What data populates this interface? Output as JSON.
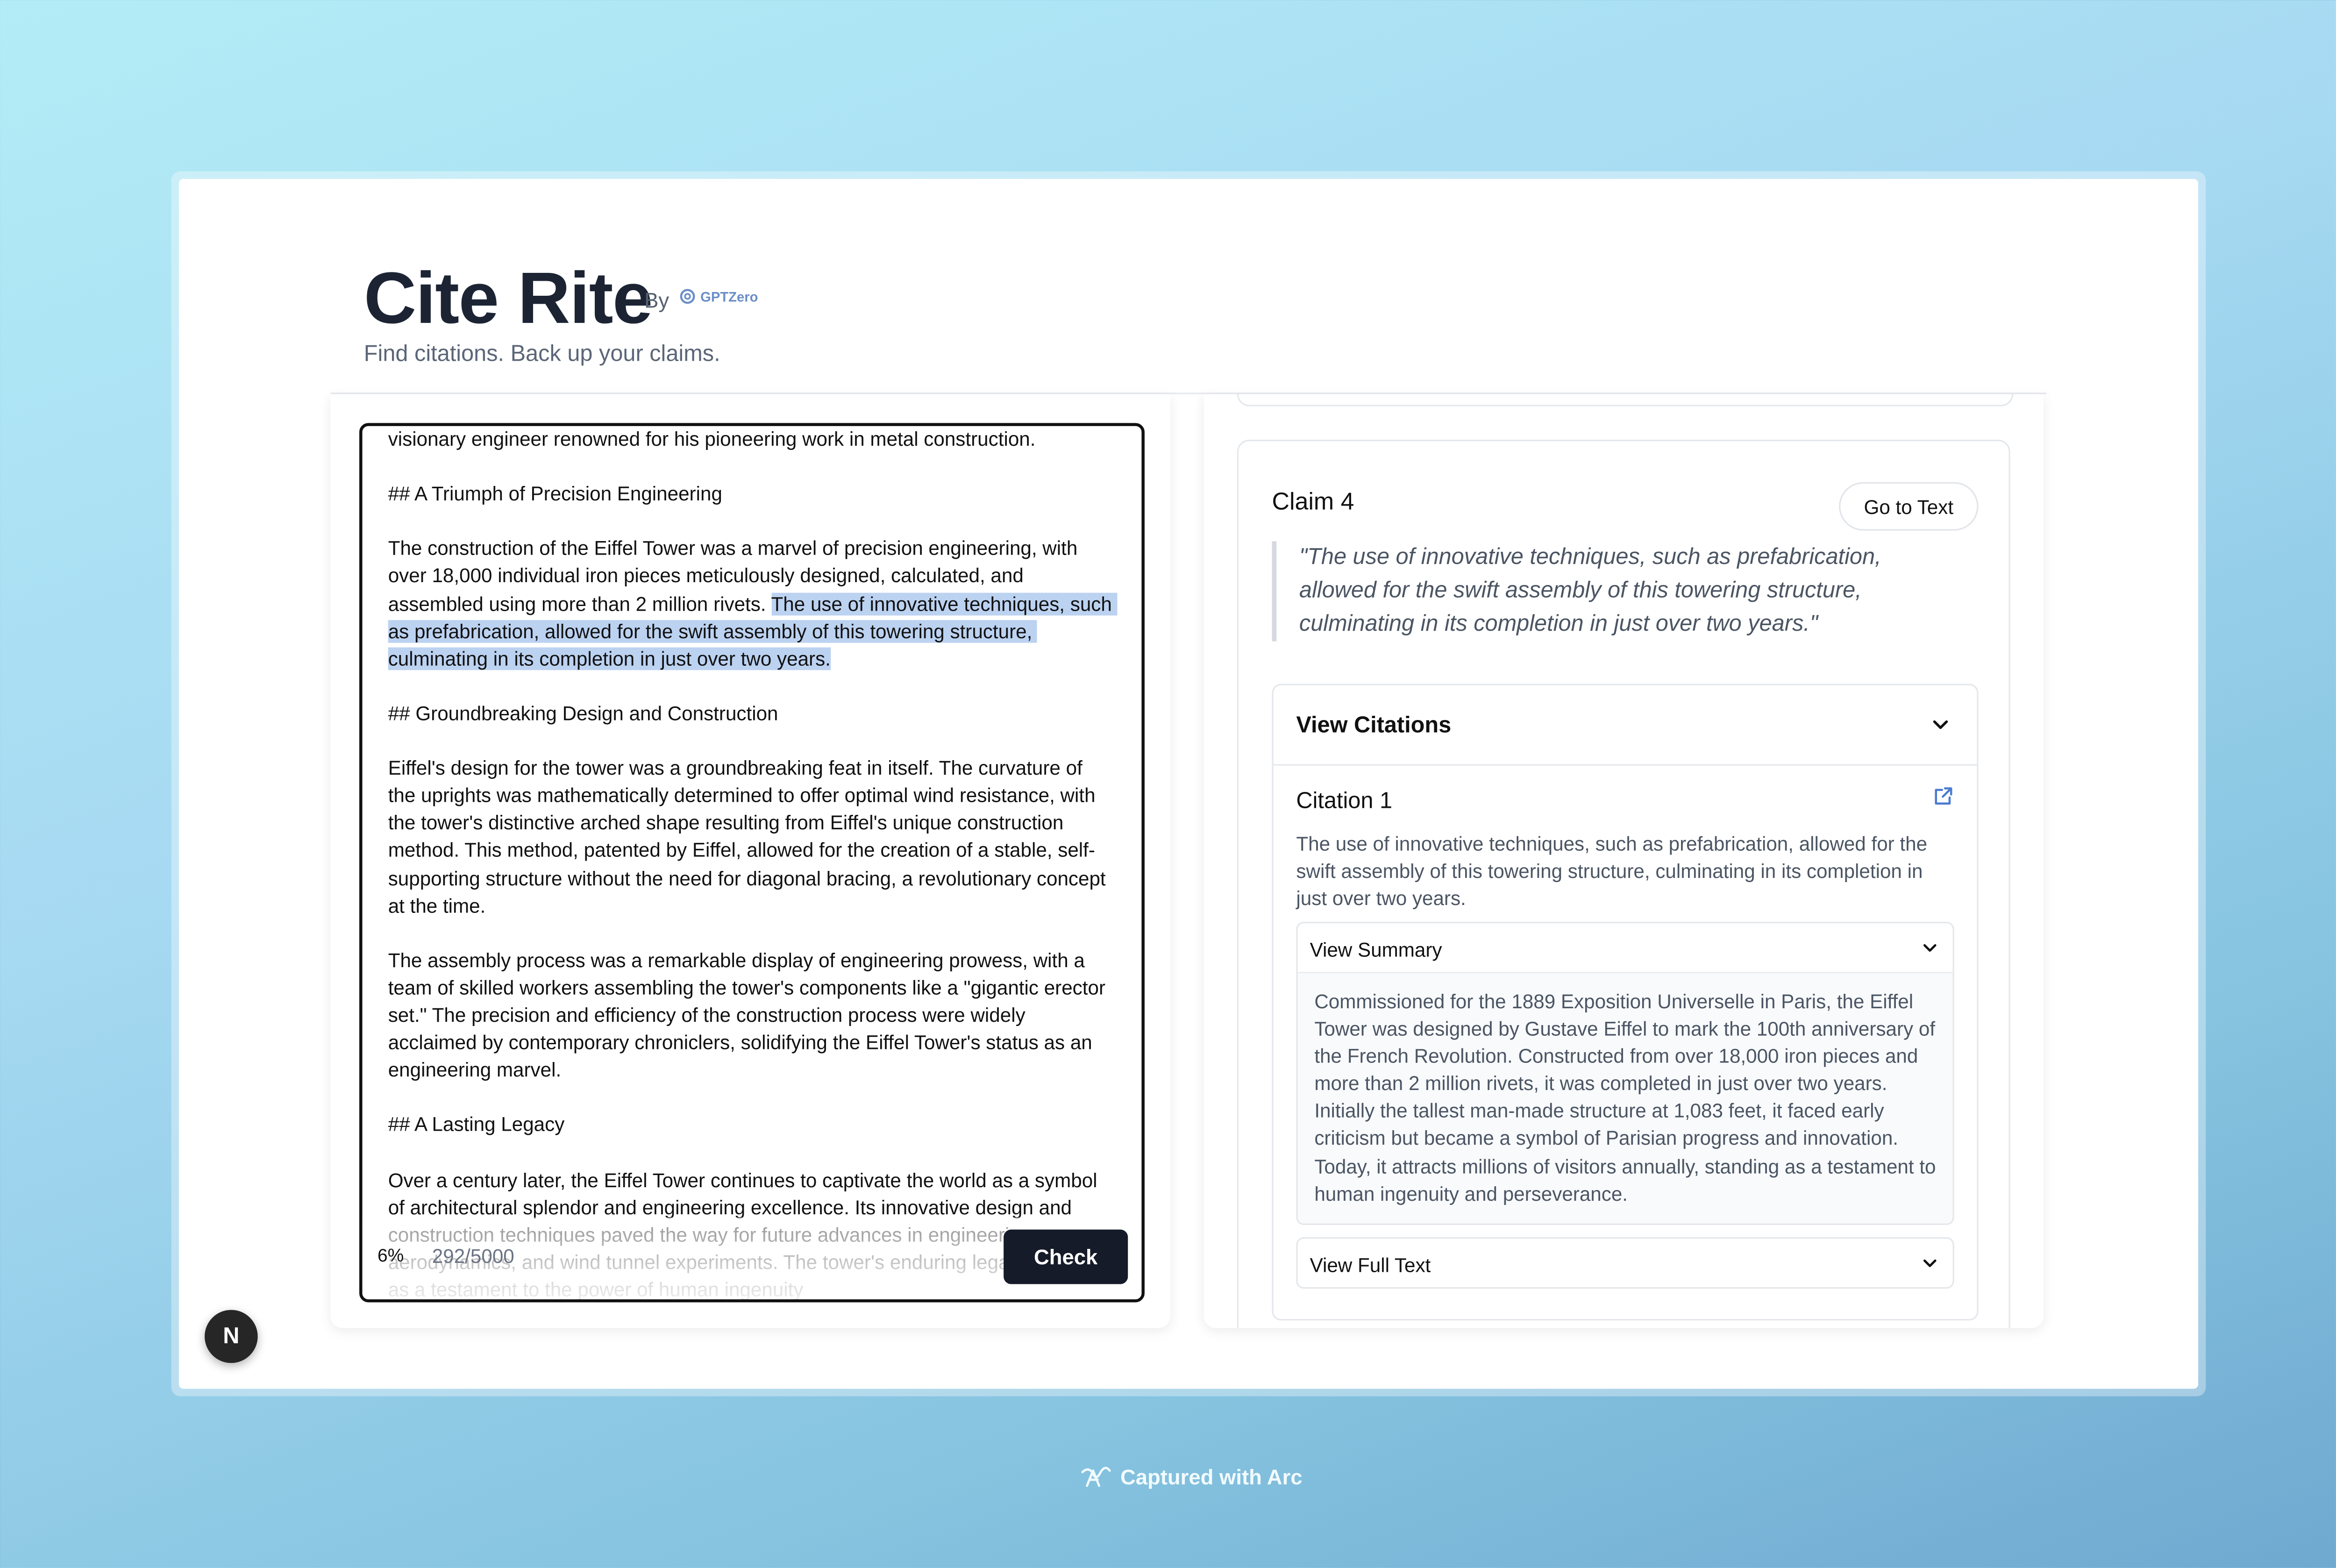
{
  "app": {
    "title": "Cite Rite",
    "by_label": "By",
    "brand": "GPTZero",
    "subtitle": "Find citations. Back up your claims."
  },
  "editor": {
    "text_before": "visionary engineer renowned for his pioneering work in metal construction.\n\n## A Triumph of Precision Engineering\n\nThe construction of the Eiffel Tower was a marvel of precision engineering, with over 18,000 individual iron pieces meticulously designed, calculated, and assembled using more than 2 million rivets. ",
    "text_highlight": "The use of innovative techniques, such as prefabrication, allowed for the swift assembly of this towering structure, culminating in its completion in just over two years.",
    "text_after": "\n\n## Groundbreaking Design and Construction\n\nEiffel's design for the tower was a groundbreaking feat in itself. The curvature of the uprights was mathematically determined to offer optimal wind resistance, with the tower's distinctive arched shape resulting from Eiffel's unique construction method. This method, patented by Eiffel, allowed for the creation of a stable, self-supporting structure without the need for diagonal bracing, a revolutionary concept at the time.\n\nThe assembly process was a remarkable display of engineering prowess, with a team of skilled workers assembling the tower's components like a \"gigantic erector set.\" The precision and efficiency of the construction process were widely acclaimed by contemporary chroniclers, solidifying the Eiffel Tower's status as an engineering marvel.\n\n## A Lasting Legacy\n\nOver a century later, the Eiffel Tower continues to captivate the world as a symbol of architectural splendor and engineering excellence. Its innovative design and construction techniques paved the way for future advances in engineering, aerodynamics, and wind tunnel experiments. The tower's enduring legacy serves as a testament to the power of human ingenuity",
    "percent": "6%",
    "char_count": "292/5000",
    "check_label": "Check"
  },
  "claim": {
    "title": "Claim 4",
    "goto_label": "Go to Text",
    "quote": "\"The use of innovative techniques, such as prefabrication, allowed for the swift assembly of this towering structure, culminating in its completion in just over two years.\"",
    "view_citations_label": "View Citations",
    "citation": {
      "title": "Citation 1",
      "text": "The use of innovative techniques, such as prefabrication, allowed for the swift assembly of this towering structure, culminating in its completion in just over two years.",
      "view_summary_label": "View Summary",
      "summary": "Commissioned for the 1889 Exposition Universelle in Paris, the Eiffel Tower was designed by Gustave Eiffel to mark the 100th anniversary of the French Revolution. Constructed from over 18,000 iron pieces and more than 2 million rivets, it was completed in just over two years. Initially the tallest man-made structure at 1,083 feet, it faced early criticism but became a symbol of Parisian progress and innovation. Today, it attracts millions of visitors annually, standing as a testament to human ingenuity and perseverance.",
      "view_full_text_label": "View Full Text"
    }
  },
  "overlay": {
    "n_badge": "N",
    "arc_caption": "Captured with Arc"
  },
  "icons": {
    "external_link": "external-link-icon",
    "chevron": "chevron-down-icon",
    "gptzero": "gptzero-logo-icon",
    "arc": "arc-logo-icon"
  },
  "colors": {
    "highlight": "#bcd2f1",
    "check_button": "#151b28",
    "title_text": "#1c2434",
    "link_icon": "#4a7bd0"
  }
}
